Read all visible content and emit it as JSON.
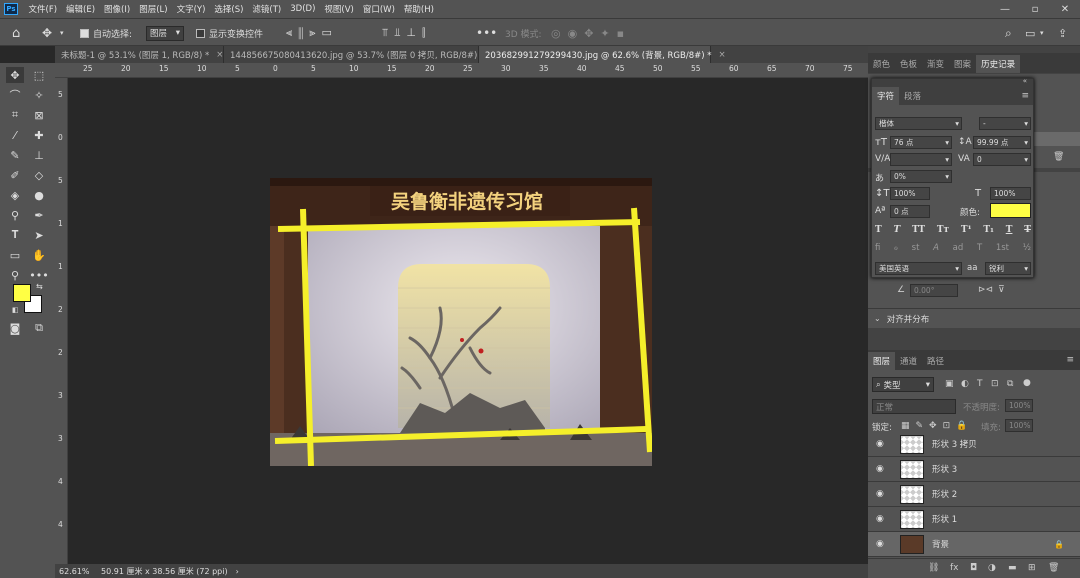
{
  "menu": {
    "logo": "Ps",
    "items": [
      "文件(F)",
      "编辑(E)",
      "图像(I)",
      "图层(L)",
      "文字(Y)",
      "选择(S)",
      "滤镜(T)",
      "3D(D)",
      "视图(V)",
      "窗口(W)",
      "帮助(H)"
    ]
  },
  "options": {
    "auto_select_label": "自动选择:",
    "auto_select_value": "图层",
    "show_transform_label": "显示变换控件",
    "mode_3d_label": "3D 模式:"
  },
  "tabs": [
    {
      "label": "未标题-1 @ 53.1% (图层 1, RGB/8) *",
      "close": "×"
    },
    {
      "label": "1448566750804136​20.jpg @ 53.7% (图层 0 拷贝, RGB/8#) *",
      "close": "×"
    },
    {
      "label": "2036829912792994​30.jpg @ 62.6% (背景, RGB/8#) *",
      "close": "×"
    }
  ],
  "ruler": {
    "h_ticks": [
      "25",
      "20",
      "15",
      "10",
      "5",
      "0",
      "5",
      "10",
      "15",
      "20",
      "25",
      "30",
      "35",
      "40",
      "45",
      "50",
      "55",
      "60",
      "65",
      "70",
      "75"
    ],
    "v_ticks": [
      "5",
      "0",
      "5",
      "1",
      "1",
      "2",
      "2",
      "3",
      "3",
      "4",
      "4"
    ]
  },
  "canvas": {
    "banner_text": "吴鲁衡非遗传习馆",
    "border_color": "#f5ef2a"
  },
  "colors": {
    "foreground": "#ffff44",
    "background": "#ffffff",
    "accent": "#31a8ff"
  },
  "status": {
    "zoom": "62.61%",
    "doc_size": "50.91 厘米 x 38.56 厘米 (72 ppi)",
    "arrow": "›"
  },
  "top_panel": {
    "tabs": [
      "颜色",
      "色板",
      "渐变",
      "图案",
      "历史记录"
    ]
  },
  "character": {
    "tabs": [
      "字符",
      "段落"
    ],
    "font_family": "楷体",
    "font_style": "-",
    "size": "76 点",
    "leading": "99.99 点",
    "tracking": "0",
    "scale_pct": "0%",
    "vscale": "100%",
    "hscale": "100%",
    "baseline": "0 点",
    "color_label": "颜色:",
    "color": "#ffff44",
    "style_buttons": [
      "T",
      "T",
      "TT",
      "Tт",
      "T¹",
      "T₁",
      "T",
      "T"
    ],
    "ot_buttons": [
      "fi",
      "ℴ",
      "st",
      "A",
      "ad",
      "T",
      "1st",
      "½"
    ],
    "language": "美国英语",
    "aa_label": "aa",
    "aa_value": "锐利"
  },
  "properties": {
    "angle": "0.00°",
    "align_section": "对齐并分布"
  },
  "layers_panel": {
    "tabs": [
      "图层",
      "通道",
      "路径"
    ],
    "filter_label": "类型",
    "blend_mode": "正常",
    "opacity_label": "不透明度:",
    "opacity_value": "100%",
    "lock_label": "锁定:",
    "fill_label": "填充:",
    "fill_value": "100%",
    "layers": [
      {
        "name": "形状 3 拷贝"
      },
      {
        "name": "形状 3"
      },
      {
        "name": "形状 2"
      },
      {
        "name": "形状 1"
      },
      {
        "name": "背景"
      }
    ]
  }
}
